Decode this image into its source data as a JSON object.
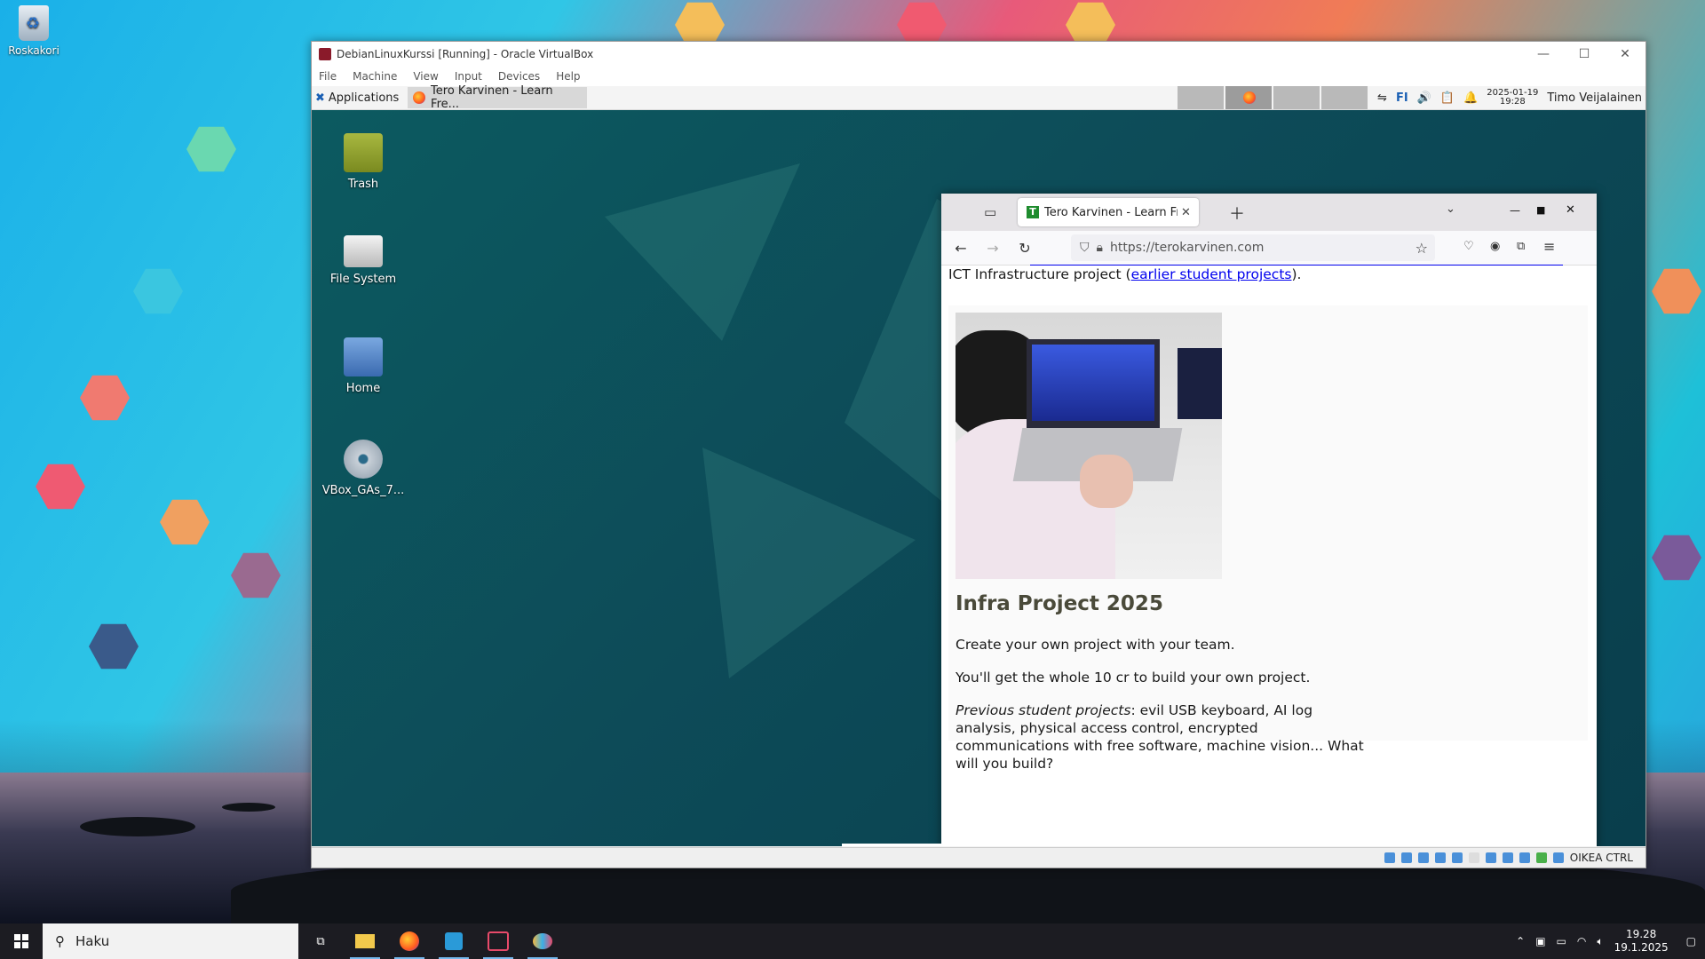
{
  "host_desktop": {
    "recycle_bin_label": "Roskakori"
  },
  "vbox": {
    "title": "DebianLinuxKurssi [Running] - Oracle VirtualBox",
    "menu": [
      "File",
      "Machine",
      "View",
      "Input",
      "Devices",
      "Help"
    ],
    "status_host_key": "OIKEA CTRL"
  },
  "guest_panel": {
    "applications": "Applications",
    "task_label": "Tero Karvinen - Learn Fre...",
    "keyboard_layout": "FI",
    "date": "2025-01-19",
    "time": "19:28",
    "user": "Timo Veijalainen"
  },
  "guest_desktop": {
    "icons": [
      "Trash",
      "File System",
      "Home",
      "VBox_GAs_7..."
    ]
  },
  "firefox": {
    "tab_title": "Tero Karvinen - Learn Free",
    "url": "https://terokarvinen.com",
    "page": {
      "intro_prefix": "ICT Infrastructure project (",
      "intro_link": "earlier student projects",
      "intro_suffix": ").",
      "heading": "Infra Project 2025",
      "para1": "Create your own project with your team.",
      "para2": "You'll get the whole 10 cr to build your own project.",
      "para3_em": "Previous student projects",
      "para3_rest": ": evil USB keyboard, AI log analysis, physical access control, encrypted communications with free software, machine vision... What will you build?"
    }
  },
  "taskbar": {
    "search_placeholder": "Haku",
    "time": "19.28",
    "date": "19.1.2025"
  },
  "colors": {
    "link": "#0000ee",
    "heading": "#4a4a3a",
    "taskbar": "#1c1c22",
    "guest_bg": "#0c5a60"
  }
}
